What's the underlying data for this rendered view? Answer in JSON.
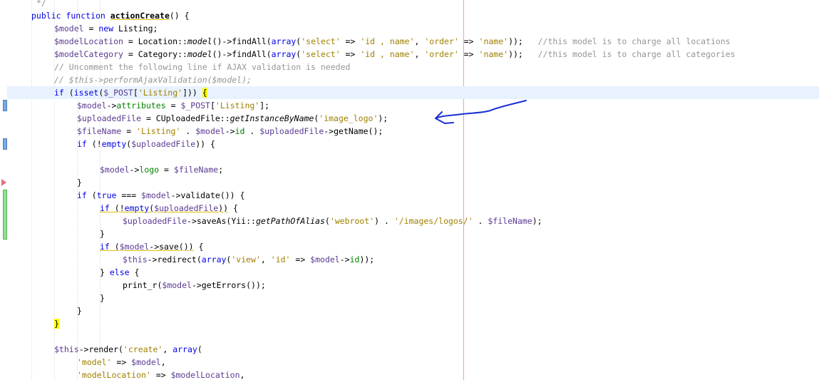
{
  "editor": {
    "colors": {
      "keyword": "#0000e6",
      "variable": "#5b3a92",
      "string": "#a08000",
      "comment": "#969696",
      "member": "#008000",
      "current_line": "#e8f2fe",
      "margin_line": "#f0a0a0",
      "bracket_highlight": "#ffff00",
      "annotation": "#1a2ed6"
    },
    "lines": [
      {
        "indent": 1,
        "current": false,
        "tokens": [
          {
            "t": " */",
            "c": "c"
          }
        ]
      },
      {
        "indent": 1,
        "current": false,
        "tokens": [
          {
            "t": "public function ",
            "c": "k"
          },
          {
            "t": "actionCreate",
            "c": "b u"
          },
          {
            "t": "() {",
            "c": "t"
          }
        ]
      },
      {
        "indent": 2,
        "current": false,
        "tokens": [
          {
            "t": "$model",
            "c": "v"
          },
          {
            "t": " = ",
            "c": "t"
          },
          {
            "t": "new",
            "c": "k"
          },
          {
            "t": " Listing;",
            "c": "t"
          }
        ]
      },
      {
        "indent": 2,
        "current": false,
        "tokens": [
          {
            "t": "$modelLocation",
            "c": "v"
          },
          {
            "t": " = Location::",
            "c": "t"
          },
          {
            "t": "model",
            "c": "i"
          },
          {
            "t": "()->findAll(",
            "c": "t"
          },
          {
            "t": "array",
            "c": "k"
          },
          {
            "t": "(",
            "c": "t"
          },
          {
            "t": "'select'",
            "c": "s"
          },
          {
            "t": " => ",
            "c": "t"
          },
          {
            "t": "'id , name'",
            "c": "s"
          },
          {
            "t": ", ",
            "c": "t"
          },
          {
            "t": "'order'",
            "c": "s"
          },
          {
            "t": " => ",
            "c": "t"
          },
          {
            "t": "'name'",
            "c": "s"
          },
          {
            "t": "));   ",
            "c": "t"
          },
          {
            "t": "//this model is to charge all locations",
            "c": "c"
          }
        ]
      },
      {
        "indent": 2,
        "current": false,
        "tokens": [
          {
            "t": "$modelCategory",
            "c": "v"
          },
          {
            "t": " = Category::",
            "c": "t"
          },
          {
            "t": "model",
            "c": "i"
          },
          {
            "t": "()->findAll(",
            "c": "t"
          },
          {
            "t": "array",
            "c": "k"
          },
          {
            "t": "(",
            "c": "t"
          },
          {
            "t": "'select'",
            "c": "s"
          },
          {
            "t": " => ",
            "c": "t"
          },
          {
            "t": "'id , name'",
            "c": "s"
          },
          {
            "t": ", ",
            "c": "t"
          },
          {
            "t": "'order'",
            "c": "s"
          },
          {
            "t": " => ",
            "c": "t"
          },
          {
            "t": "'name'",
            "c": "s"
          },
          {
            "t": "));   ",
            "c": "t"
          },
          {
            "t": "//this model is to charge all categories",
            "c": "c"
          }
        ]
      },
      {
        "indent": 2,
        "current": false,
        "tokens": [
          {
            "t": "// Uncomment the following line if AJAX validation is needed",
            "c": "c"
          }
        ]
      },
      {
        "indent": 2,
        "current": false,
        "tokens": [
          {
            "t": "// $this->performAjaxValidation($model);",
            "c": "c i"
          }
        ]
      },
      {
        "indent": 2,
        "current": true,
        "tokens": [
          {
            "t": "if",
            "c": "k"
          },
          {
            "t": " (",
            "c": "t"
          },
          {
            "t": "isset",
            "c": "k"
          },
          {
            "t": "(",
            "c": "t"
          },
          {
            "t": "$_POST",
            "c": "v"
          },
          {
            "t": "[",
            "c": "t"
          },
          {
            "t": "'Listing'",
            "c": "s"
          },
          {
            "t": "])) ",
            "c": "t"
          },
          {
            "t": "{",
            "c": "t hl"
          }
        ]
      },
      {
        "indent": 3,
        "current": false,
        "tokens": [
          {
            "t": "$model",
            "c": "v"
          },
          {
            "t": "->",
            "c": "t"
          },
          {
            "t": "attributes",
            "c": "m"
          },
          {
            "t": " = ",
            "c": "t"
          },
          {
            "t": "$_POST",
            "c": "v"
          },
          {
            "t": "[",
            "c": "t"
          },
          {
            "t": "'Listing'",
            "c": "s"
          },
          {
            "t": "];",
            "c": "t"
          }
        ]
      },
      {
        "indent": 3,
        "current": false,
        "tokens": [
          {
            "t": "$uploadedFile",
            "c": "v"
          },
          {
            "t": " = CUploadedFile::",
            "c": "t"
          },
          {
            "t": "getInstanceByName",
            "c": "i"
          },
          {
            "t": "(",
            "c": "t"
          },
          {
            "t": "'image_logo'",
            "c": "s"
          },
          {
            "t": ");",
            "c": "t"
          }
        ]
      },
      {
        "indent": 3,
        "current": false,
        "tokens": [
          {
            "t": "$fileName",
            "c": "v"
          },
          {
            "t": " = ",
            "c": "t"
          },
          {
            "t": "'Listing'",
            "c": "s"
          },
          {
            "t": " . ",
            "c": "t"
          },
          {
            "t": "$model",
            "c": "v"
          },
          {
            "t": "->",
            "c": "t"
          },
          {
            "t": "id",
            "c": "m"
          },
          {
            "t": " . ",
            "c": "t"
          },
          {
            "t": "$uploadedFile",
            "c": "v"
          },
          {
            "t": "->getName();",
            "c": "t"
          }
        ]
      },
      {
        "indent": 3,
        "current": false,
        "tokens": [
          {
            "t": "if",
            "c": "k"
          },
          {
            "t": " (!",
            "c": "t"
          },
          {
            "t": "empty",
            "c": "k"
          },
          {
            "t": "(",
            "c": "t"
          },
          {
            "t": "$uploadedFile",
            "c": "v"
          },
          {
            "t": ")) {",
            "c": "t"
          }
        ]
      },
      {
        "indent": 0,
        "current": false,
        "tokens": []
      },
      {
        "indent": 4,
        "current": false,
        "tokens": [
          {
            "t": "$model",
            "c": "v"
          },
          {
            "t": "->",
            "c": "t"
          },
          {
            "t": "logo",
            "c": "m"
          },
          {
            "t": " = ",
            "c": "t"
          },
          {
            "t": "$fileName",
            "c": "v"
          },
          {
            "t": ";",
            "c": "t"
          }
        ]
      },
      {
        "indent": 3,
        "current": false,
        "tokens": [
          {
            "t": "}",
            "c": "t"
          }
        ]
      },
      {
        "indent": 3,
        "current": false,
        "tokens": [
          {
            "t": "if",
            "c": "k"
          },
          {
            "t": " (",
            "c": "t"
          },
          {
            "t": "true",
            "c": "k"
          },
          {
            "t": " === ",
            "c": "t"
          },
          {
            "t": "$model",
            "c": "v"
          },
          {
            "t": "->validate()) {",
            "c": "t"
          }
        ]
      },
      {
        "indent": 4,
        "current": false,
        "tokens": [
          {
            "t": "if",
            "c": "k u"
          },
          {
            "t": " (!",
            "c": "t u"
          },
          {
            "t": "empty",
            "c": "k u"
          },
          {
            "t": "(",
            "c": "t u"
          },
          {
            "t": "$uploadedFile",
            "c": "v u"
          },
          {
            "t": "))",
            "c": "t u"
          },
          {
            "t": " {",
            "c": "t"
          }
        ]
      },
      {
        "indent": 5,
        "current": false,
        "tokens": [
          {
            "t": "$uploadedFile",
            "c": "v"
          },
          {
            "t": "->saveAs(Yii::",
            "c": "t"
          },
          {
            "t": "getPathOfAlias",
            "c": "i"
          },
          {
            "t": "(",
            "c": "t"
          },
          {
            "t": "'webroot'",
            "c": "s"
          },
          {
            "t": ") . ",
            "c": "t"
          },
          {
            "t": "'/images/logos/'",
            "c": "s"
          },
          {
            "t": " . ",
            "c": "t"
          },
          {
            "t": "$fileName",
            "c": "v"
          },
          {
            "t": ");",
            "c": "t"
          }
        ]
      },
      {
        "indent": 4,
        "current": false,
        "tokens": [
          {
            "t": "}",
            "c": "t"
          }
        ]
      },
      {
        "indent": 4,
        "current": false,
        "tokens": [
          {
            "t": "if",
            "c": "k u"
          },
          {
            "t": " (",
            "c": "t u"
          },
          {
            "t": "$model",
            "c": "v u"
          },
          {
            "t": "->save())",
            "c": "t u"
          },
          {
            "t": " {",
            "c": "t"
          }
        ]
      },
      {
        "indent": 5,
        "current": false,
        "tokens": [
          {
            "t": "$this",
            "c": "v"
          },
          {
            "t": "->redirect(",
            "c": "t"
          },
          {
            "t": "array",
            "c": "k"
          },
          {
            "t": "(",
            "c": "t"
          },
          {
            "t": "'view'",
            "c": "s"
          },
          {
            "t": ", ",
            "c": "t"
          },
          {
            "t": "'id'",
            "c": "s"
          },
          {
            "t": " => ",
            "c": "t"
          },
          {
            "t": "$model",
            "c": "v"
          },
          {
            "t": "->",
            "c": "t"
          },
          {
            "t": "id",
            "c": "m"
          },
          {
            "t": "));",
            "c": "t"
          }
        ]
      },
      {
        "indent": 4,
        "current": false,
        "tokens": [
          {
            "t": "} ",
            "c": "t"
          },
          {
            "t": "else",
            "c": "k"
          },
          {
            "t": " {",
            "c": "t"
          }
        ]
      },
      {
        "indent": 5,
        "current": false,
        "tokens": [
          {
            "t": "print_r(",
            "c": "t"
          },
          {
            "t": "$model",
            "c": "v"
          },
          {
            "t": "->getErrors());",
            "c": "t"
          }
        ]
      },
      {
        "indent": 4,
        "current": false,
        "tokens": [
          {
            "t": "}",
            "c": "t"
          }
        ]
      },
      {
        "indent": 3,
        "current": false,
        "tokens": [
          {
            "t": "}",
            "c": "t"
          }
        ]
      },
      {
        "indent": 2,
        "current": false,
        "tokens": [
          {
            "t": "}",
            "c": "t hl"
          }
        ]
      },
      {
        "indent": 0,
        "current": false,
        "tokens": []
      },
      {
        "indent": 2,
        "current": false,
        "tokens": [
          {
            "t": "$this",
            "c": "v"
          },
          {
            "t": "->render(",
            "c": "t"
          },
          {
            "t": "'create'",
            "c": "s"
          },
          {
            "t": ", ",
            "c": "t"
          },
          {
            "t": "array",
            "c": "k"
          },
          {
            "t": "(",
            "c": "t"
          }
        ]
      },
      {
        "indent": 3,
        "current": false,
        "tokens": [
          {
            "t": "'model'",
            "c": "s"
          },
          {
            "t": " => ",
            "c": "t"
          },
          {
            "t": "$model",
            "c": "v"
          },
          {
            "t": ",",
            "c": "t"
          }
        ]
      },
      {
        "indent": 3,
        "current": false,
        "tokens": [
          {
            "t": "'modelLocation'",
            "c": "s"
          },
          {
            "t": " => ",
            "c": "t"
          },
          {
            "t": "$modelLocation",
            "c": "v"
          },
          {
            "t": ",",
            "c": "t"
          }
        ]
      }
    ],
    "gutter_markers": [
      {
        "type": "change",
        "line": 9,
        "color": "#7aa7e6"
      },
      {
        "type": "change",
        "line": 12,
        "color": "#7aa7e6"
      },
      {
        "type": "error",
        "line": 15,
        "color": "#e07080"
      },
      {
        "type": "add",
        "line": 16,
        "span": 4,
        "color": "#90e090"
      }
    ]
  }
}
